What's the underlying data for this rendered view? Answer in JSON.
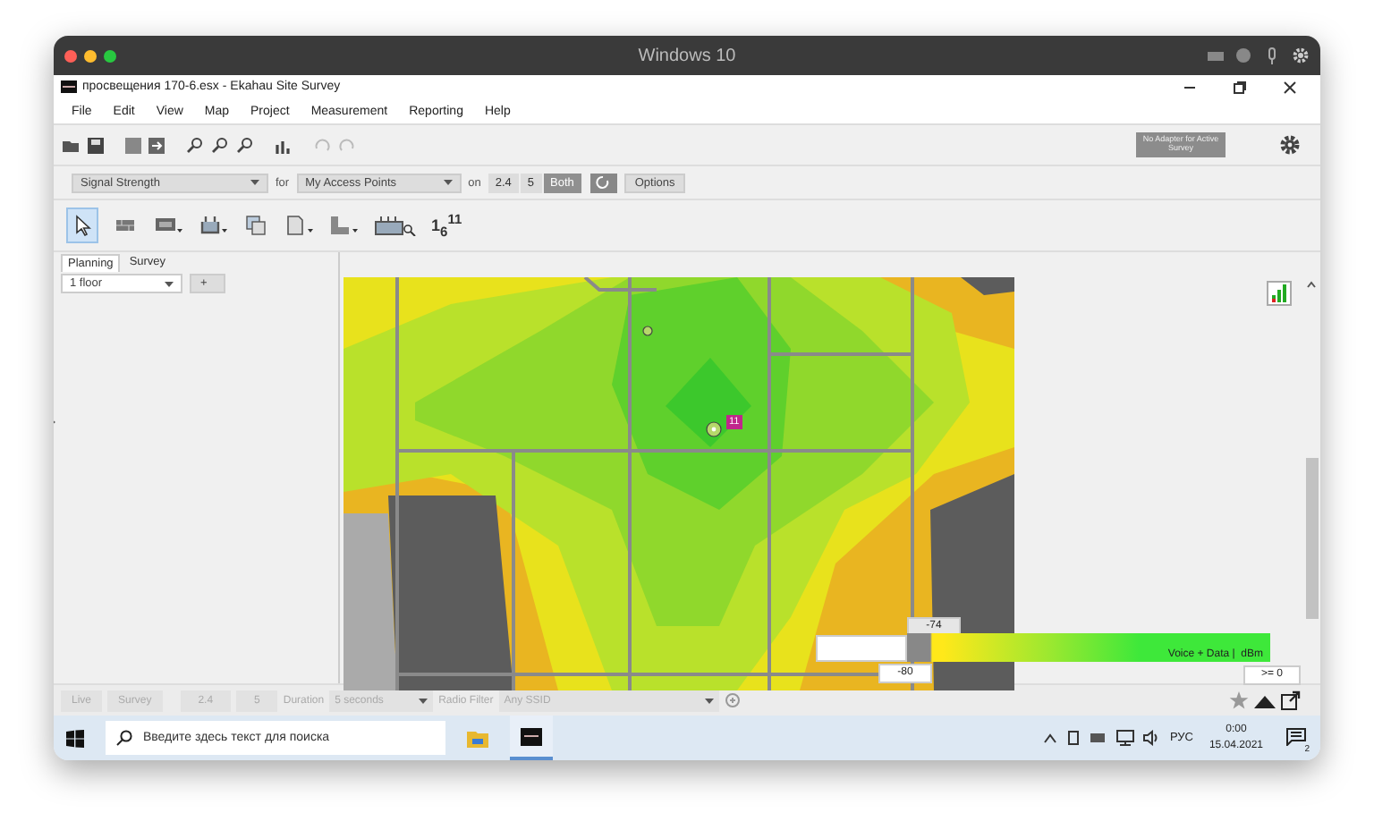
{
  "mac_window": {
    "title": "Windows 10"
  },
  "app": {
    "title": "просвещения 170-6.esx - Ekahau Site Survey"
  },
  "menu": [
    "File",
    "Edit",
    "View",
    "Map",
    "Project",
    "Measurement",
    "Reporting",
    "Help"
  ],
  "adapter_status": "No Adapter for Active Survey",
  "view_bar": {
    "visualization": "Signal Strength",
    "for_label": "for",
    "source": "My Access Points",
    "on_label": "on",
    "options": "Options",
    "bands": [
      {
        "label": "2.4",
        "selected": false
      },
      {
        "label": "5",
        "selected": false
      },
      {
        "label": "Both",
        "selected": true
      }
    ]
  },
  "tools": [
    {
      "kind": "pointer",
      "selected": true
    },
    {
      "kind": "wall",
      "selected": false
    },
    {
      "kind": "wall-menu",
      "selected": false
    },
    {
      "kind": "ap-menu",
      "selected": false
    },
    {
      "kind": "copy",
      "selected": false
    },
    {
      "kind": "note-menu",
      "selected": false
    },
    {
      "kind": "area-menu",
      "selected": false
    },
    {
      "kind": "auto-plan",
      "selected": false
    }
  ],
  "channel_tool_label": "1$_{6}$$^{11}$",
  "side_tabs": [
    {
      "label": "Planning",
      "selected": true
    },
    {
      "label": "Survey",
      "selected": false
    }
  ],
  "floor": "1 floor",
  "add_floor": "+",
  "map": {
    "ap_channel": "11"
  },
  "legend": {
    "upper_value": "-74",
    "lower_value": "-80",
    "caption": "Voice + Data |  dBm",
    "max_label": ">= 0"
  },
  "survey_bar": {
    "disabled": true,
    "modes": [
      "Live",
      "Survey"
    ],
    "bands": [
      "2.4",
      "5"
    ],
    "duration_label": "Duration",
    "duration": "5 seconds",
    "radio_filter_label": "Radio Filter",
    "radio_filter": "Any SSID"
  },
  "taskbar": {
    "search_placeholder": "Введите здесь текст для поиска",
    "language": "РУС",
    "time": "0:00",
    "date": "15.04.2021",
    "notifications": "2"
  }
}
